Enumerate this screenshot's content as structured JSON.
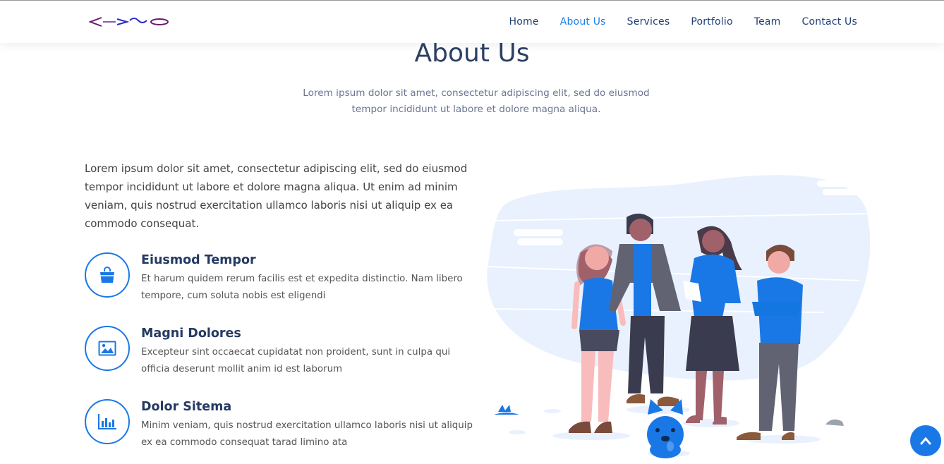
{
  "nav": {
    "items": [
      {
        "label": "Home",
        "active": false
      },
      {
        "label": "About Us",
        "active": true
      },
      {
        "label": "Services",
        "active": false
      },
      {
        "label": "Portfolio",
        "active": false
      },
      {
        "label": "Team",
        "active": false
      },
      {
        "label": "Contact Us",
        "active": false
      }
    ]
  },
  "about": {
    "title": "About Us",
    "subtitle": "Lorem ipsum dolor sit amet, consectetur adipiscing elit, sed do eiusmod tempor incididunt ut labore et dolore magna aliqua.",
    "intro": "Lorem ipsum dolor sit amet, consectetur adipiscing elit, sed do eiusmod tempor incididunt ut labore et dolore magna aliqua. Ut enim ad minim veniam, quis nostrud exercitation ullamco laboris nisi ut aliquip ex ea commodo consequat.",
    "features": [
      {
        "icon": "shopping-bag-icon",
        "title": "Eiusmod Tempor",
        "text": "Et harum quidem rerum facilis est et expedita distinctio. Nam libero tempore, cum soluta nobis est eligendi"
      },
      {
        "icon": "image-icon",
        "title": "Magni Dolores",
        "text": "Excepteur sint occaecat cupidatat non proident, sunt in culpa qui officia deserunt mollit anim id est laborum"
      },
      {
        "icon": "bar-chart-icon",
        "title": "Dolor Sitema",
        "text": "Minim veniam, quis nostrud exercitation ullamco laboris nisi ut aliquip ex ea commodo consequat tarad limino ata"
      }
    ]
  },
  "colors": {
    "accent": "#1a78e6",
    "heading": "#253a63",
    "nav_text": "#1f3f75"
  },
  "back_to_top": {
    "icon": "chevron-up-icon"
  }
}
